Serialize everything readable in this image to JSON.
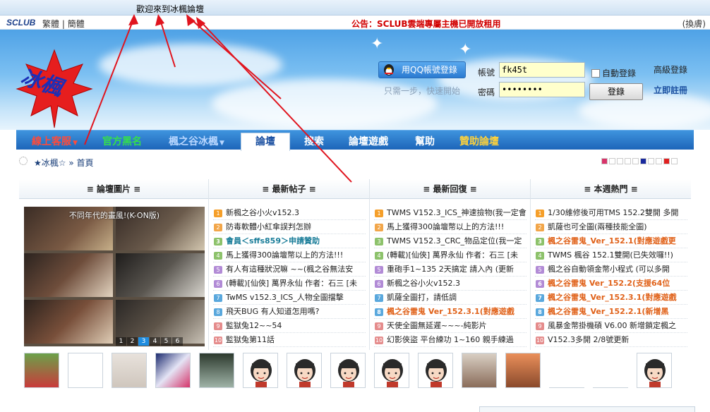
{
  "welcome": "歡迎來到冰楓論壇",
  "top": {
    "logo": "SCLUB",
    "lang_trad": "繁體",
    "lang_sep": "|",
    "lang_simp": "簡體",
    "notice": "公告：SCLUB雲端專屬主機已開放租用",
    "switch": "(換膚)"
  },
  "header": {
    "logo_text": "冰楓",
    "qq_button": "用QQ帳號登錄",
    "qq_sub": "只需一步，快速開始",
    "username_label": "帳號",
    "username_value": "fk45t",
    "password_label": "密碼",
    "password_value": "••••••••",
    "auto_login": "自動登錄",
    "login_button": "登錄",
    "advanced_login": "高級登錄",
    "register": "立即註冊"
  },
  "nav": {
    "items": [
      {
        "label": "線上客服",
        "color": "#ff4b3a"
      },
      {
        "label": "官方黑名",
        "color": "#35e04a"
      },
      {
        "label": "楓之谷冰楓",
        "color": "#b9d7ff"
      },
      {
        "label": "論壇",
        "color": "#1a4fa0"
      },
      {
        "label": "搜索",
        "color": "#ffffff"
      },
      {
        "label": "論壇遊戲",
        "color": "#ffffff"
      },
      {
        "label": "幫助",
        "color": "#ffffff"
      },
      {
        "label": "贊助論壇",
        "color": "#ffd23a"
      }
    ]
  },
  "breadcrumb": {
    "site": "★冰楓☆",
    "sep": "»",
    "home": "首頁"
  },
  "swatches": [
    "#d8346a",
    "#ffffff",
    "#ffffff",
    "#ffffff",
    "#ffffff",
    "#1a2a9e",
    "#ffffff",
    "#ffffff",
    "#e02020",
    "#ffffff"
  ],
  "panels": {
    "pictures": {
      "title": "≡ 論壇圖片 ≡",
      "caption": "不同年代的畫風!(K-ON版)",
      "pager": [
        "1",
        "2",
        "3",
        "4",
        "5",
        "6"
      ]
    },
    "latest": {
      "title": "≡ 最新帖子 ≡",
      "items": [
        "新楓之谷小火v152.3",
        "防毒軟體小紅傘誤判怎辦",
        "會員＜sffs859＞申請贊助",
        "馬上獲得300論壇幣以上的方法!!!",
        "有人有這種狀況嘛 ~~(楓之谷無法安",
        "(轉載)[仙俠] 萬界永仙 作者：石三 [未",
        "TwMS v152.3_ICS_人物全圖擋擊",
        "飛天BUG 有人知道怎用嗎?",
        "監獄兔12~~54",
        "監獄兔第11話"
      ]
    },
    "replies": {
      "title": "≡ 最新回復 ≡",
      "items": [
        "TWMS V152.3_ICS_神速撿物(我一定會",
        "馬上獲得300論壇幣以上的方法!!!",
        "TWMS V152.3_CRC_物品定位(我一定",
        "(轉載)[仙俠] 萬界永仙 作者：石三 [未",
        "重砲手1~135 2天搞定 請入內 (更新",
        "新楓之谷小火v152.3",
        "凱薩全圖打，請低調",
        "楓之谷雷鬼 Ver_152.3.1(對應遊戲",
        "天使全圖無延遲~~~-純影片",
        "幻影俠盜 平台練功 1~160 親手練過"
      ]
    },
    "hot": {
      "title": "≡ 本週熱門 ≡",
      "items": [
        "1/30維修後可用TMS 152.2雙開 多開",
        "凱薩也可全圖(兩種技能全圖)",
        "楓之谷雷鬼_Ver_152.1(對應遊戲更",
        "TWMS 楓谷 152.1雙開(已失效囉!!)",
        "楓之谷自動領金幣小程式 (可以多開",
        "楓之谷雷鬼 Ver_152.2(支援64位",
        "楓之谷雷鬼_Ver_152.3.1(對應遊戲",
        "楓之谷雷鬼_Ver_152.2.1(新增黑",
        "風暴金幣掛機碩 V6.00 新增鎖定楓之",
        "V152.3多開 2/8號更新"
      ]
    },
    "numbers": [
      "1",
      "2",
      "3",
      "4",
      "5",
      "6",
      "7",
      "8",
      "9",
      "10"
    ]
  },
  "colors": {
    "sky_top": "#4fa2e6",
    "nav_bg": "#1d65b9",
    "notice_red": "#d10000",
    "arrow_red": "#e0141e"
  }
}
